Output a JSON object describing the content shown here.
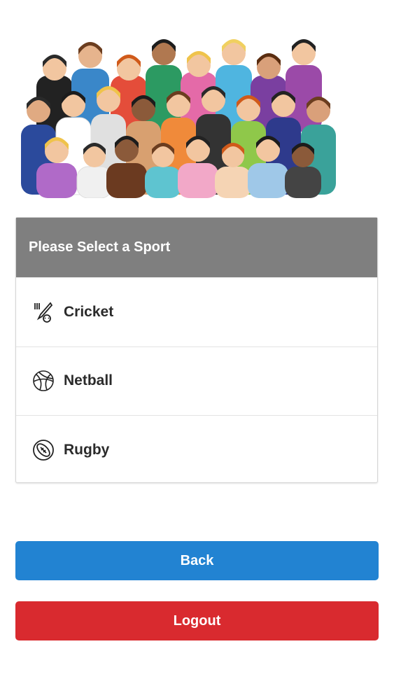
{
  "header": {
    "title": "Please Select a Sport"
  },
  "sports": [
    {
      "label": "Cricket",
      "icon": "cricket-icon"
    },
    {
      "label": "Netball",
      "icon": "netball-icon"
    },
    {
      "label": "Rugby",
      "icon": "rugby-icon"
    }
  ],
  "buttons": {
    "back_label": "Back",
    "logout_label": "Logout"
  },
  "colors": {
    "header_bg": "#7f7f7f",
    "back_button": "#2283d2",
    "logout_button": "#d92a2f"
  }
}
